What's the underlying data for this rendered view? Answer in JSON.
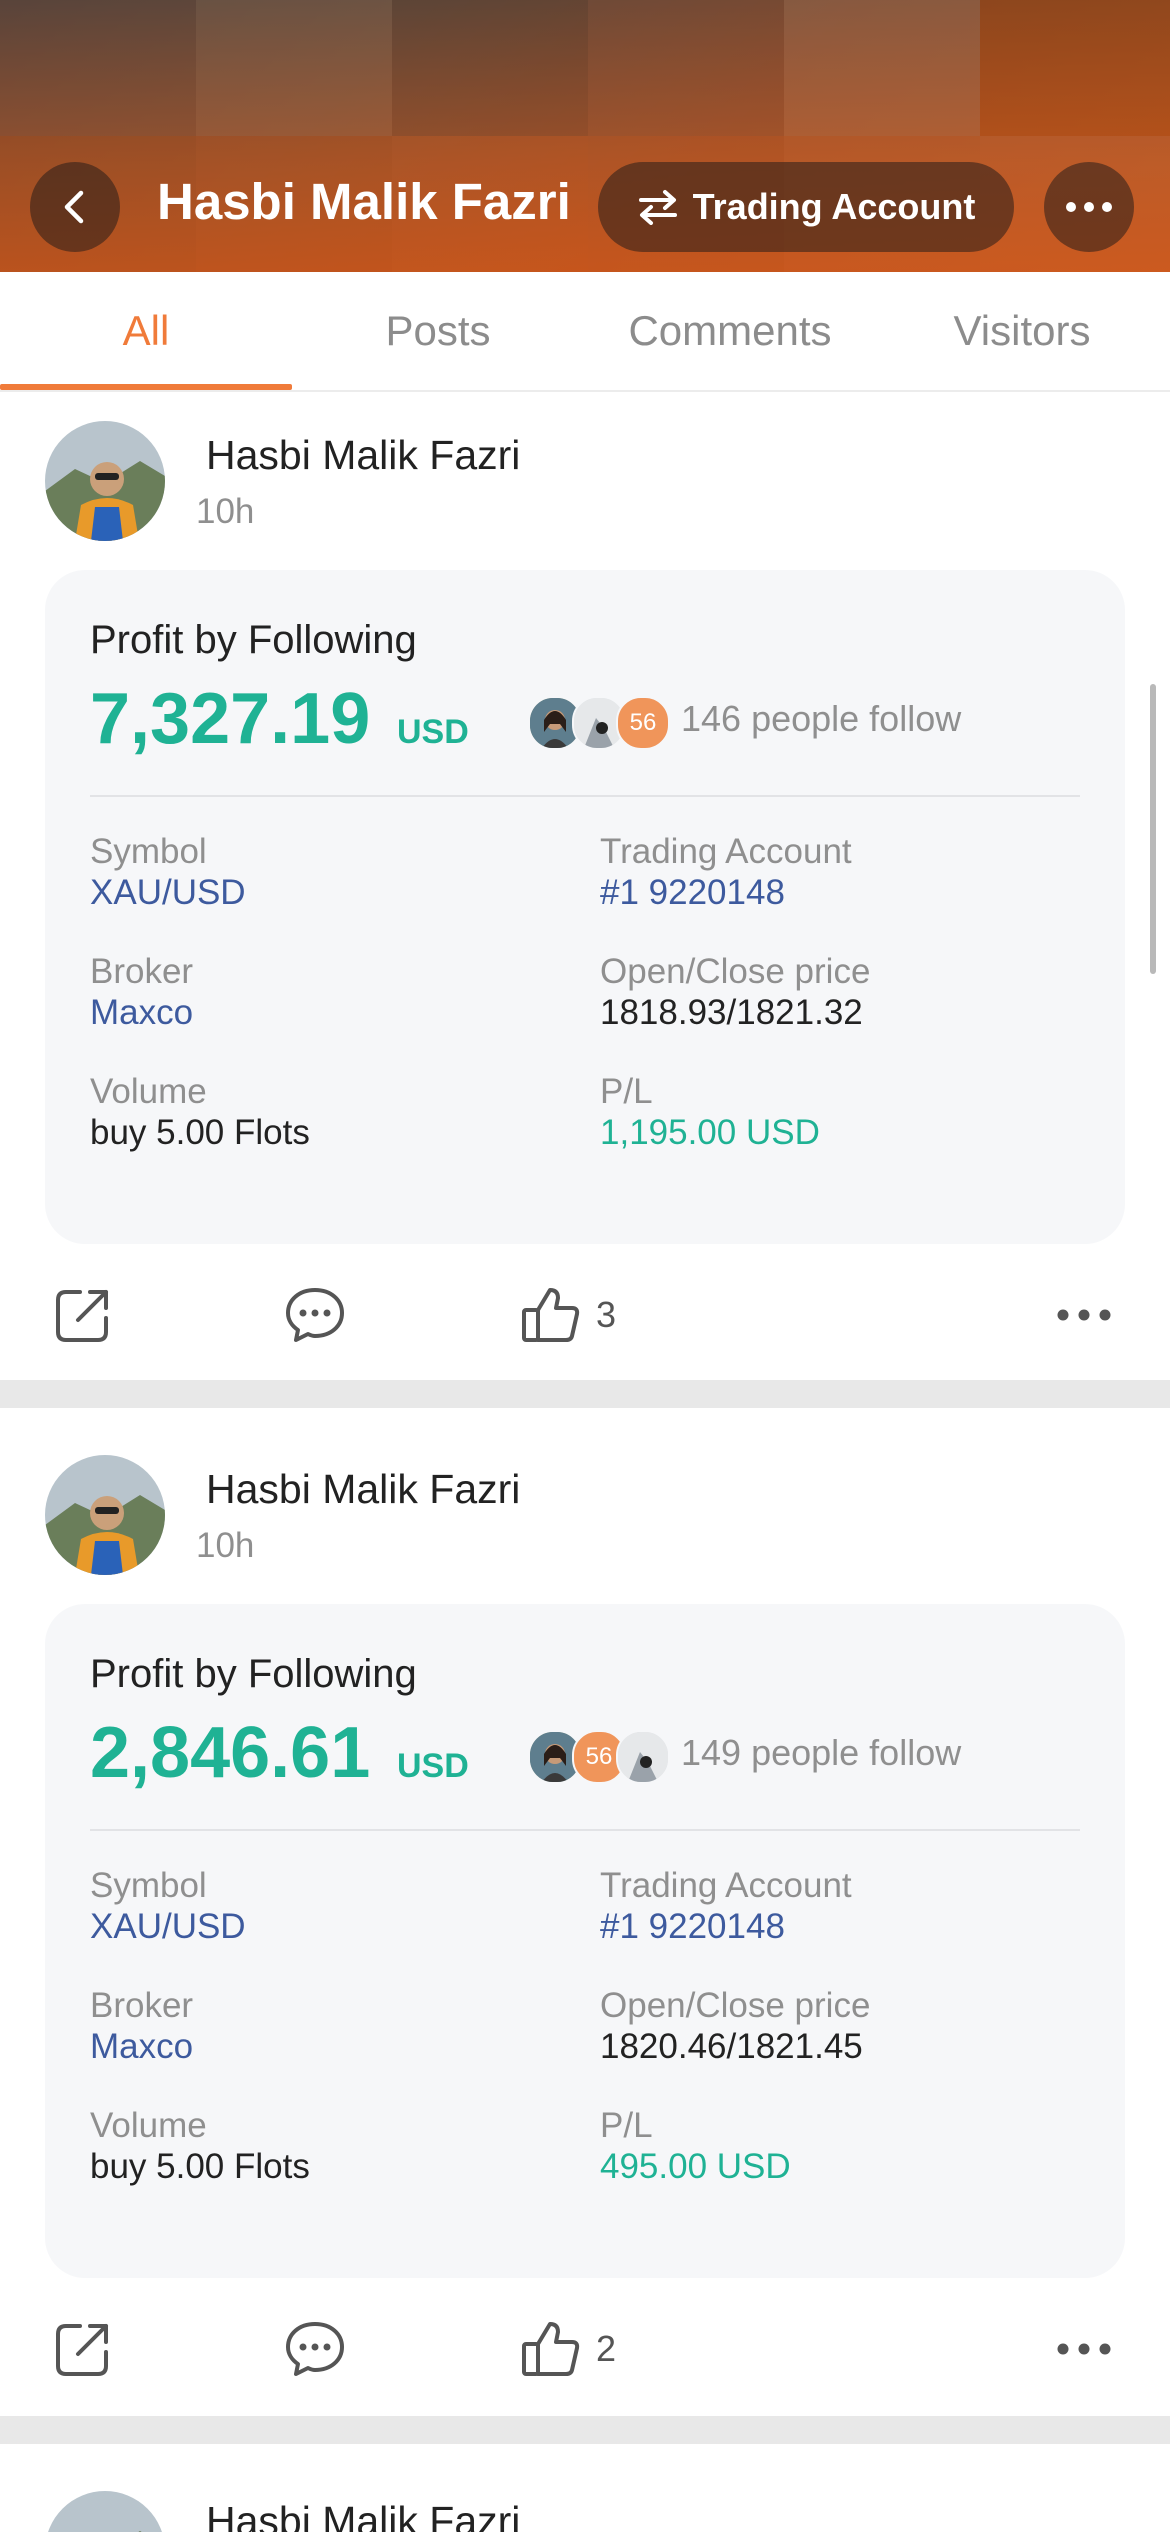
{
  "header": {
    "title": "Hasbi Malik Fazri",
    "trading_account_label": "Trading Account",
    "back_icon": "chevron-left-icon",
    "switch_icon": "swap-arrows-icon",
    "more_icon": "more-horizontal-icon"
  },
  "tabs": [
    {
      "label": "All",
      "active": true
    },
    {
      "label": "Posts",
      "active": false
    },
    {
      "label": "Comments",
      "active": false
    },
    {
      "label": "Visitors",
      "active": false
    }
  ],
  "colors": {
    "accent": "#f07b3a",
    "profit_green": "#1fb294",
    "link_blue": "#3d5a9e"
  },
  "posts": [
    {
      "author": "Hasbi Malik Fazri",
      "time": "10h",
      "card": {
        "title": "Profit by Following",
        "profit": "7,327.19",
        "currency": "USD",
        "follower_badge": "56",
        "followers": "146 people follow",
        "symbol_label": "Symbol",
        "symbol": "XAU/USD",
        "account_label": "Trading Account",
        "account": "#1 9220148",
        "broker_label": "Broker",
        "broker": "Maxco",
        "price_label": "Open/Close price",
        "price": "1818.93/1821.32",
        "volume_label": "Volume",
        "volume": "buy 5.00 Flots",
        "pl_label": "P/L",
        "pl": "1,195.00 USD"
      },
      "likes": "3"
    },
    {
      "author": "Hasbi Malik Fazri",
      "time": "10h",
      "card": {
        "title": "Profit by Following",
        "profit": "2,846.61",
        "currency": "USD",
        "follower_badge": "56",
        "followers": "149 people follow",
        "symbol_label": "Symbol",
        "symbol": "XAU/USD",
        "account_label": "Trading Account",
        "account": "#1 9220148",
        "broker_label": "Broker",
        "broker": "Maxco",
        "price_label": "Open/Close price",
        "price": "1820.46/1821.45",
        "volume_label": "Volume",
        "volume": "buy 5.00 Flots",
        "pl_label": "P/L",
        "pl": "495.00 USD"
      },
      "likes": "2"
    },
    {
      "author": "Hasbi Malik Fazri"
    }
  ],
  "action_icons": [
    "share-icon",
    "comment-icon",
    "thumbs-up-icon",
    "more-horizontal-icon"
  ]
}
